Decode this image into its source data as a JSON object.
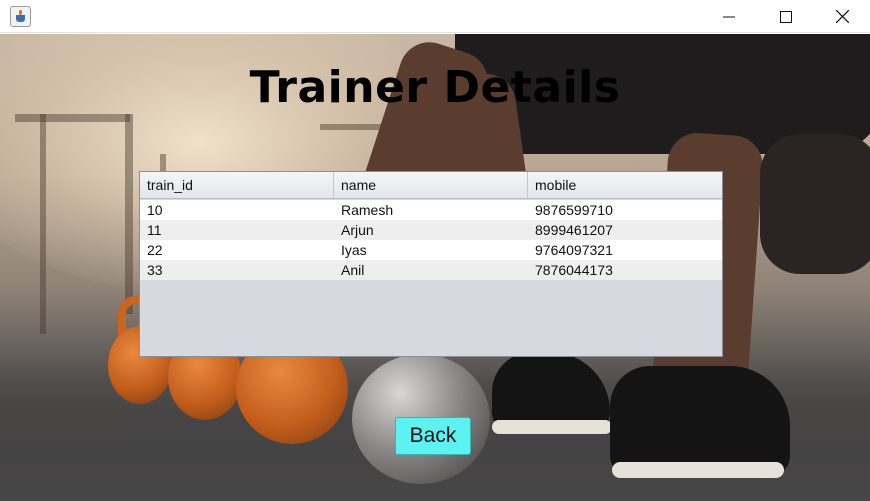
{
  "window": {
    "icons": {
      "app": "java-cup-icon",
      "minimize": "minimize-icon",
      "maximize": "maximize-icon",
      "close": "close-icon"
    }
  },
  "heading": "Trainer Details",
  "table": {
    "columns": [
      "train_id",
      "name",
      "mobile"
    ],
    "rows": [
      [
        "10",
        "Ramesh",
        "9876599710"
      ],
      [
        "11",
        "Arjun",
        "8999461207"
      ],
      [
        "22",
        "Iyas",
        "9764097321"
      ],
      [
        "33",
        "Anil",
        "7876044173"
      ]
    ]
  },
  "back_button": {
    "label": "Back"
  },
  "colors": {
    "button": "#5df2f2",
    "table_background": "#d6d9e0",
    "heading": "#000000"
  }
}
